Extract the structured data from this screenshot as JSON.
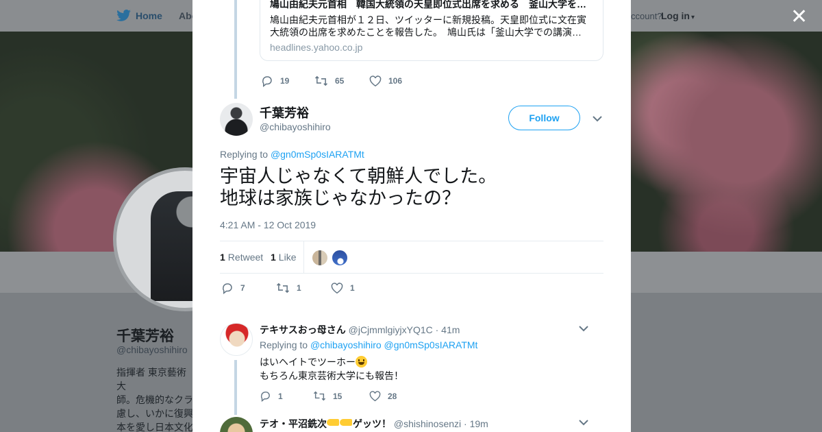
{
  "background": {
    "nav": {
      "home": "Home",
      "about": "Abo",
      "account_question": "ccount?",
      "login": "Log in"
    },
    "profile": {
      "name": "千葉芳裕",
      "handle": "@chibayoshihiro",
      "bio": "指揮者 東京藝術大\n師。危機的なクラ\n慮し、いかに復興\n本を愛し日本文化\n写真と鉄道。特に"
    }
  },
  "modal": {
    "link_card": {
      "title": "鳩山由紀夫元首相　韓国大統領の天皇即位式出席を求める　釜山大学を…",
      "description": "鳩山由紀夫元首相が１２日、ツイッターに新規投稿。天皇即位式に文在寅大統領の出席を求めたことを報告した。　鳩山氏は「釜山大学での講演…",
      "domain": "headlines.yahoo.co.jp"
    },
    "parent_actions": {
      "replies": "19",
      "retweets": "65",
      "likes": "106"
    },
    "tweet": {
      "author_name": "千葉芳裕",
      "author_handle": "@chibayoshihiro",
      "follow_label": "Follow",
      "replying_prefix": "Replying to",
      "replying_to": "@gn0mSp0sIARATMt",
      "text": "宇宙人じゃなくて朝鮮人でした。\n地球は家族じゃなかったの？",
      "timestamp": "4:21 AM - 12 Oct 2019",
      "stats": {
        "retweet_count": "1",
        "retweet_label": "Retweet",
        "like_count": "1",
        "like_label": "Like"
      },
      "actions": {
        "replies": "7",
        "retweets": "1",
        "likes": "1"
      }
    },
    "replies": [
      {
        "name": "テキサスおっ母さん",
        "handle": "@jCjmmlgiyjxYQ1C",
        "time": "· 41m",
        "replying_prefix": "Replying to",
        "replying_to_1": "@chibayoshihiro",
        "replying_to_2": "@gn0mSp0sIARATMt",
        "text_line1": "はいヘイトでツーホー",
        "text_line2": "もちろん東京芸術大学にも報告！",
        "actions": {
          "replies": "1",
          "retweets": "15",
          "likes": "28"
        }
      },
      {
        "name_part1": "テオ・平沼銑次",
        "name_part2": "ゲッツ！",
        "handle": "@shishinosenzi",
        "time": "· 19m"
      }
    ]
  },
  "icons": {
    "close": "close-icon",
    "reply": "reply-icon",
    "retweet": "retweet-icon",
    "like": "heart-icon",
    "chevron": "chevron-down-icon"
  },
  "colors": {
    "brand_blue": "#1da1f2",
    "muted": "#657786",
    "thread_line": "#c4d6e4"
  }
}
